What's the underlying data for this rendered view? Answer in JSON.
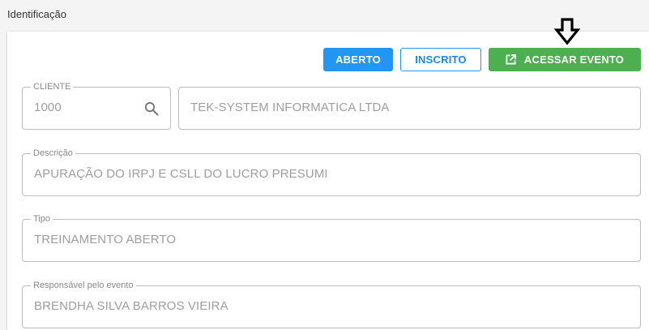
{
  "section": {
    "title": "Identificação"
  },
  "actions": {
    "aberto_label": "ABERTO",
    "inscrito_label": "INSCRITO",
    "acessar_label": "ACESSAR EVENTO"
  },
  "fields": {
    "cliente": {
      "label": "CLIENTE",
      "value": "1000"
    },
    "cliente_nome": {
      "value": "TEK-SYSTEM INFORMATICA LTDA"
    },
    "descricao": {
      "label": "Descrição",
      "value": "APURAÇÃO DO IRPJ E CSLL DO LUCRO PRESUMI"
    },
    "tipo": {
      "label": "Tipo",
      "value": "TREINAMENTO ABERTO"
    },
    "responsavel": {
      "label": "Responsável pelo evento",
      "value": "BRENDHA SILVA BARROS VIEIRA"
    }
  },
  "colors": {
    "primary_blue": "#2196f3",
    "success_green": "#4caf50",
    "field_border": "#bdbdbd",
    "field_text": "#9e9e9e"
  },
  "icons": {
    "search": "search-icon",
    "external_link": "external-link-icon",
    "annotation_arrow": "arrow-down-icon"
  }
}
